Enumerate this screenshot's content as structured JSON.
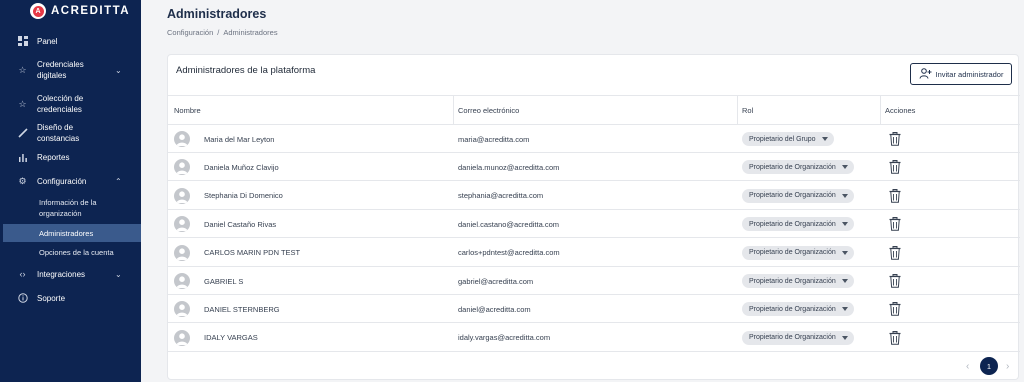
{
  "brand": {
    "name": "ACREDITTA",
    "mark": "A"
  },
  "sidebar": {
    "items": [
      {
        "id": "panel",
        "label": "Panel",
        "icon": "dashboard-icon"
      },
      {
        "id": "credenciales",
        "label": "Credenciales digitales",
        "icon": "star-icon",
        "chevron": "down"
      },
      {
        "id": "coleccion",
        "label": "Colección de credenciales",
        "icon": "star-outline-icon"
      },
      {
        "id": "diseno",
        "label": "Diseño de constancias",
        "icon": "brush-icon"
      },
      {
        "id": "reportes",
        "label": "Reportes",
        "icon": "bar-chart-icon"
      },
      {
        "id": "configuracion",
        "label": "Configuración",
        "icon": "gear-icon",
        "chevron": "up"
      },
      {
        "id": "integraciones",
        "label": "Integraciones",
        "icon": "code-icon",
        "chevron": "down"
      },
      {
        "id": "soporte",
        "label": "Soporte",
        "icon": "info-icon"
      }
    ],
    "subitems": [
      {
        "label": "Información de la organización",
        "active": false
      },
      {
        "label": "Administradores",
        "active": true
      },
      {
        "label": "Opciones de la cuenta",
        "active": false
      }
    ]
  },
  "header": {
    "title": "Administradores",
    "breadcrumb": [
      "Configuración",
      "Administradores"
    ],
    "breadcrumb_sep": "/"
  },
  "card": {
    "title": "Administradores de la plataforma",
    "invite_label": "Invitar administrador",
    "columns": [
      "Nombre",
      "Correo electrónico",
      "Rol",
      "Acciones"
    ],
    "rows": [
      {
        "name": "Maria del Mar Leyton",
        "email": "maria@acreditta.com",
        "role": "Propietario del Grupo"
      },
      {
        "name": "Daniela Muñoz Clavijo",
        "email": "daniela.munoz@acreditta.com",
        "role": "Propietario de Organización"
      },
      {
        "name": "Stephania Di Domenico",
        "email": "stephania@acreditta.com",
        "role": "Propietario de Organización"
      },
      {
        "name": "Daniel Castaño Rivas",
        "email": "daniel.castano@acreditta.com",
        "role": "Propietario de Organización"
      },
      {
        "name": "CARLOS MARIN PDN TEST",
        "email": "carlos+pdntest@acreditta.com",
        "role": "Propietario de Organización"
      },
      {
        "name": "GABRIEL S",
        "email": "gabriel@acreditta.com",
        "role": "Propietario de Organización"
      },
      {
        "name": "DANIEL STERNBERG",
        "email": "daniel@acreditta.com",
        "role": "Propietario de Organización"
      },
      {
        "name": "IDALY VARGAS",
        "email": "idaly.vargas@acreditta.com",
        "role": "Propietario de Organización"
      }
    ]
  },
  "pagination": {
    "prev": "‹",
    "current": "1",
    "next": "›"
  },
  "colors": {
    "sidebar_bg": "#0d2451",
    "active_item": "#3a5a8c",
    "brand_red": "#e63946"
  }
}
